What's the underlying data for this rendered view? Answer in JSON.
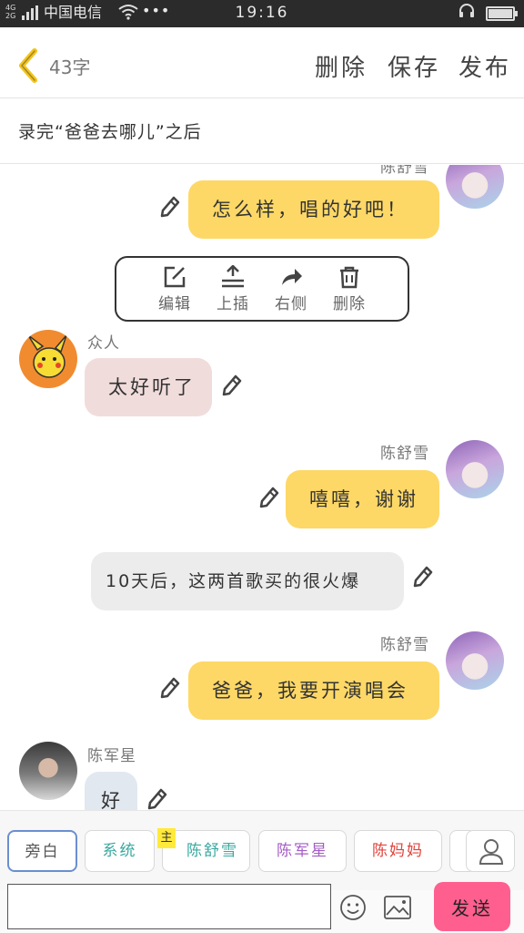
{
  "status_bar": {
    "network": "4G 2G",
    "carrier": "中国电信",
    "time": "19:16",
    "icons": [
      "signal-icon",
      "wifi-icon",
      "more-icon",
      "headset-icon",
      "battery-icon"
    ]
  },
  "header": {
    "char_count": "43字",
    "delete_label": "删除",
    "save_label": "保存",
    "publish_label": "发布",
    "back_icon": "chevron-left-icon"
  },
  "title": "录完“爸爸去哪儿”之后",
  "chat": {
    "messages": [
      {
        "speaker": "陈舒雪",
        "text": "怎么样，唱的好吧！",
        "side": "right",
        "bubble_color": "#fdd866"
      },
      {
        "speaker": "众人",
        "text": "太好听了",
        "side": "left",
        "bubble_color": "#f1dcdc"
      },
      {
        "speaker": "陈舒雪",
        "text": "嘻嘻，谢谢",
        "side": "right",
        "bubble_color": "#fdd866"
      },
      {
        "speaker": "",
        "text": "10天后，这两首歌买的很火爆",
        "side": "narration",
        "bubble_color": "#ececec"
      },
      {
        "speaker": "陈舒雪",
        "text": "爸爸，我要开演唱会",
        "side": "right",
        "bubble_color": "#fdd866"
      },
      {
        "speaker": "陈军星",
        "text": "好",
        "side": "left",
        "bubble_color": "#e2e8f0"
      }
    ],
    "context_menu": {
      "edit": "编辑",
      "insert_above": "上插",
      "right_side": "右侧",
      "delete": "删除"
    }
  },
  "roles": {
    "items": [
      "旁白",
      "系统",
      "陈舒雪",
      "陈军星",
      "陈妈妈"
    ],
    "colors": [
      "#555555",
      "#3aa9a0",
      "#3aa9a0",
      "#a45cc6",
      "#e0443c"
    ],
    "main_badge": "主",
    "selected": "旁白"
  },
  "input": {
    "placeholder": "",
    "send_label": "发送"
  },
  "colors": {
    "accent_yellow": "#fdd866",
    "send_pink": "#ff5f8f",
    "back_yellow": "#f5c518"
  }
}
